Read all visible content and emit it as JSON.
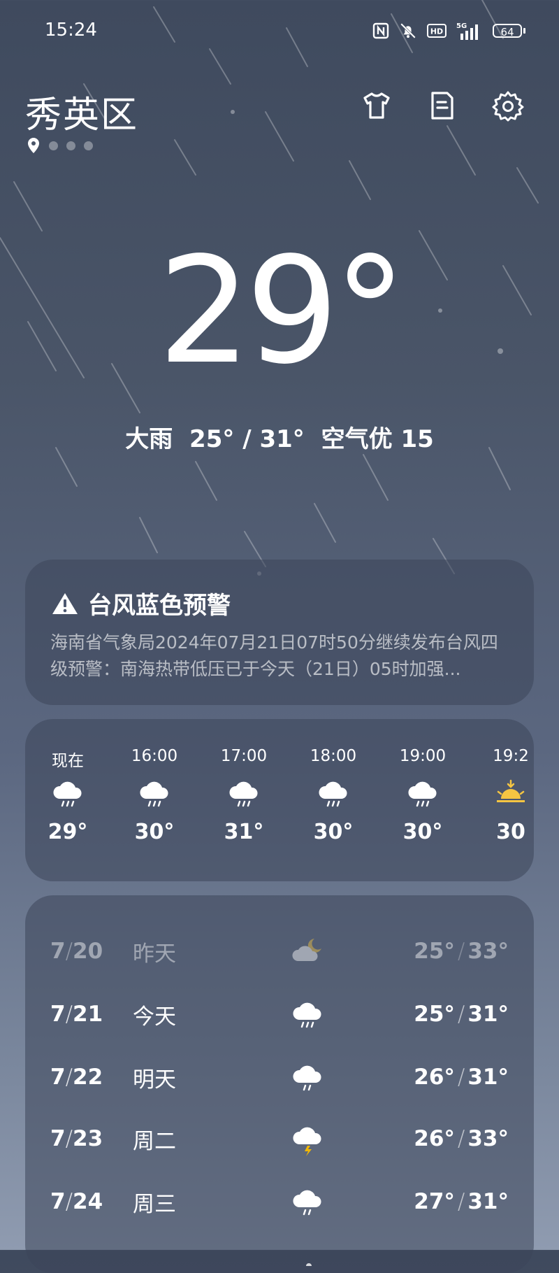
{
  "status_bar": {
    "time": "15:24",
    "battery": "64",
    "network": "5G",
    "hd": "HD"
  },
  "location": {
    "city": "秀英区"
  },
  "current": {
    "temperature": "29",
    "degree": "°",
    "condition": "大雨",
    "range": "25° / 31°",
    "air_quality": "空气优 15"
  },
  "alert": {
    "title": "台风蓝色预警",
    "text": "海南省气象局2024年07月21日07时50分继续发布台风四级预警：南海热带低压已于今天（21日）05时加强..."
  },
  "hourly": [
    {
      "time": "现在",
      "icon": "rain-cloud-icon",
      "temp": "29°"
    },
    {
      "time": "16:00",
      "icon": "rain-cloud-icon",
      "temp": "30°"
    },
    {
      "time": "17:00",
      "icon": "rain-cloud-icon",
      "temp": "31°"
    },
    {
      "time": "18:00",
      "icon": "rain-cloud-icon",
      "temp": "30°"
    },
    {
      "time": "19:00",
      "icon": "rain-cloud-icon",
      "temp": "30°"
    },
    {
      "time": "19:2",
      "icon": "sunset-icon",
      "temp": "30"
    }
  ],
  "daily": [
    {
      "date_m": "7",
      "date_d": "20",
      "label": "昨天",
      "icon": "partly-cloudy-night-icon",
      "low": "25°",
      "high": "33°",
      "past": true
    },
    {
      "date_m": "7",
      "date_d": "21",
      "label": "今天",
      "icon": "rain-cloud-icon",
      "low": "25°",
      "high": "31°"
    },
    {
      "date_m": "7",
      "date_d": "22",
      "label": "明天",
      "icon": "rain-cloud-icon",
      "low": "26°",
      "high": "31°"
    },
    {
      "date_m": "7",
      "date_d": "23",
      "label": "周二",
      "icon": "thunderstorm-icon",
      "low": "26°",
      "high": "33°"
    },
    {
      "date_m": "7",
      "date_d": "24",
      "label": "周三",
      "icon": "rain-cloud-icon",
      "low": "27°",
      "high": "31°"
    }
  ],
  "colors": {
    "alert_icon": "#ffffff",
    "sun": "#f5c542",
    "lightning": "#f2b705"
  }
}
